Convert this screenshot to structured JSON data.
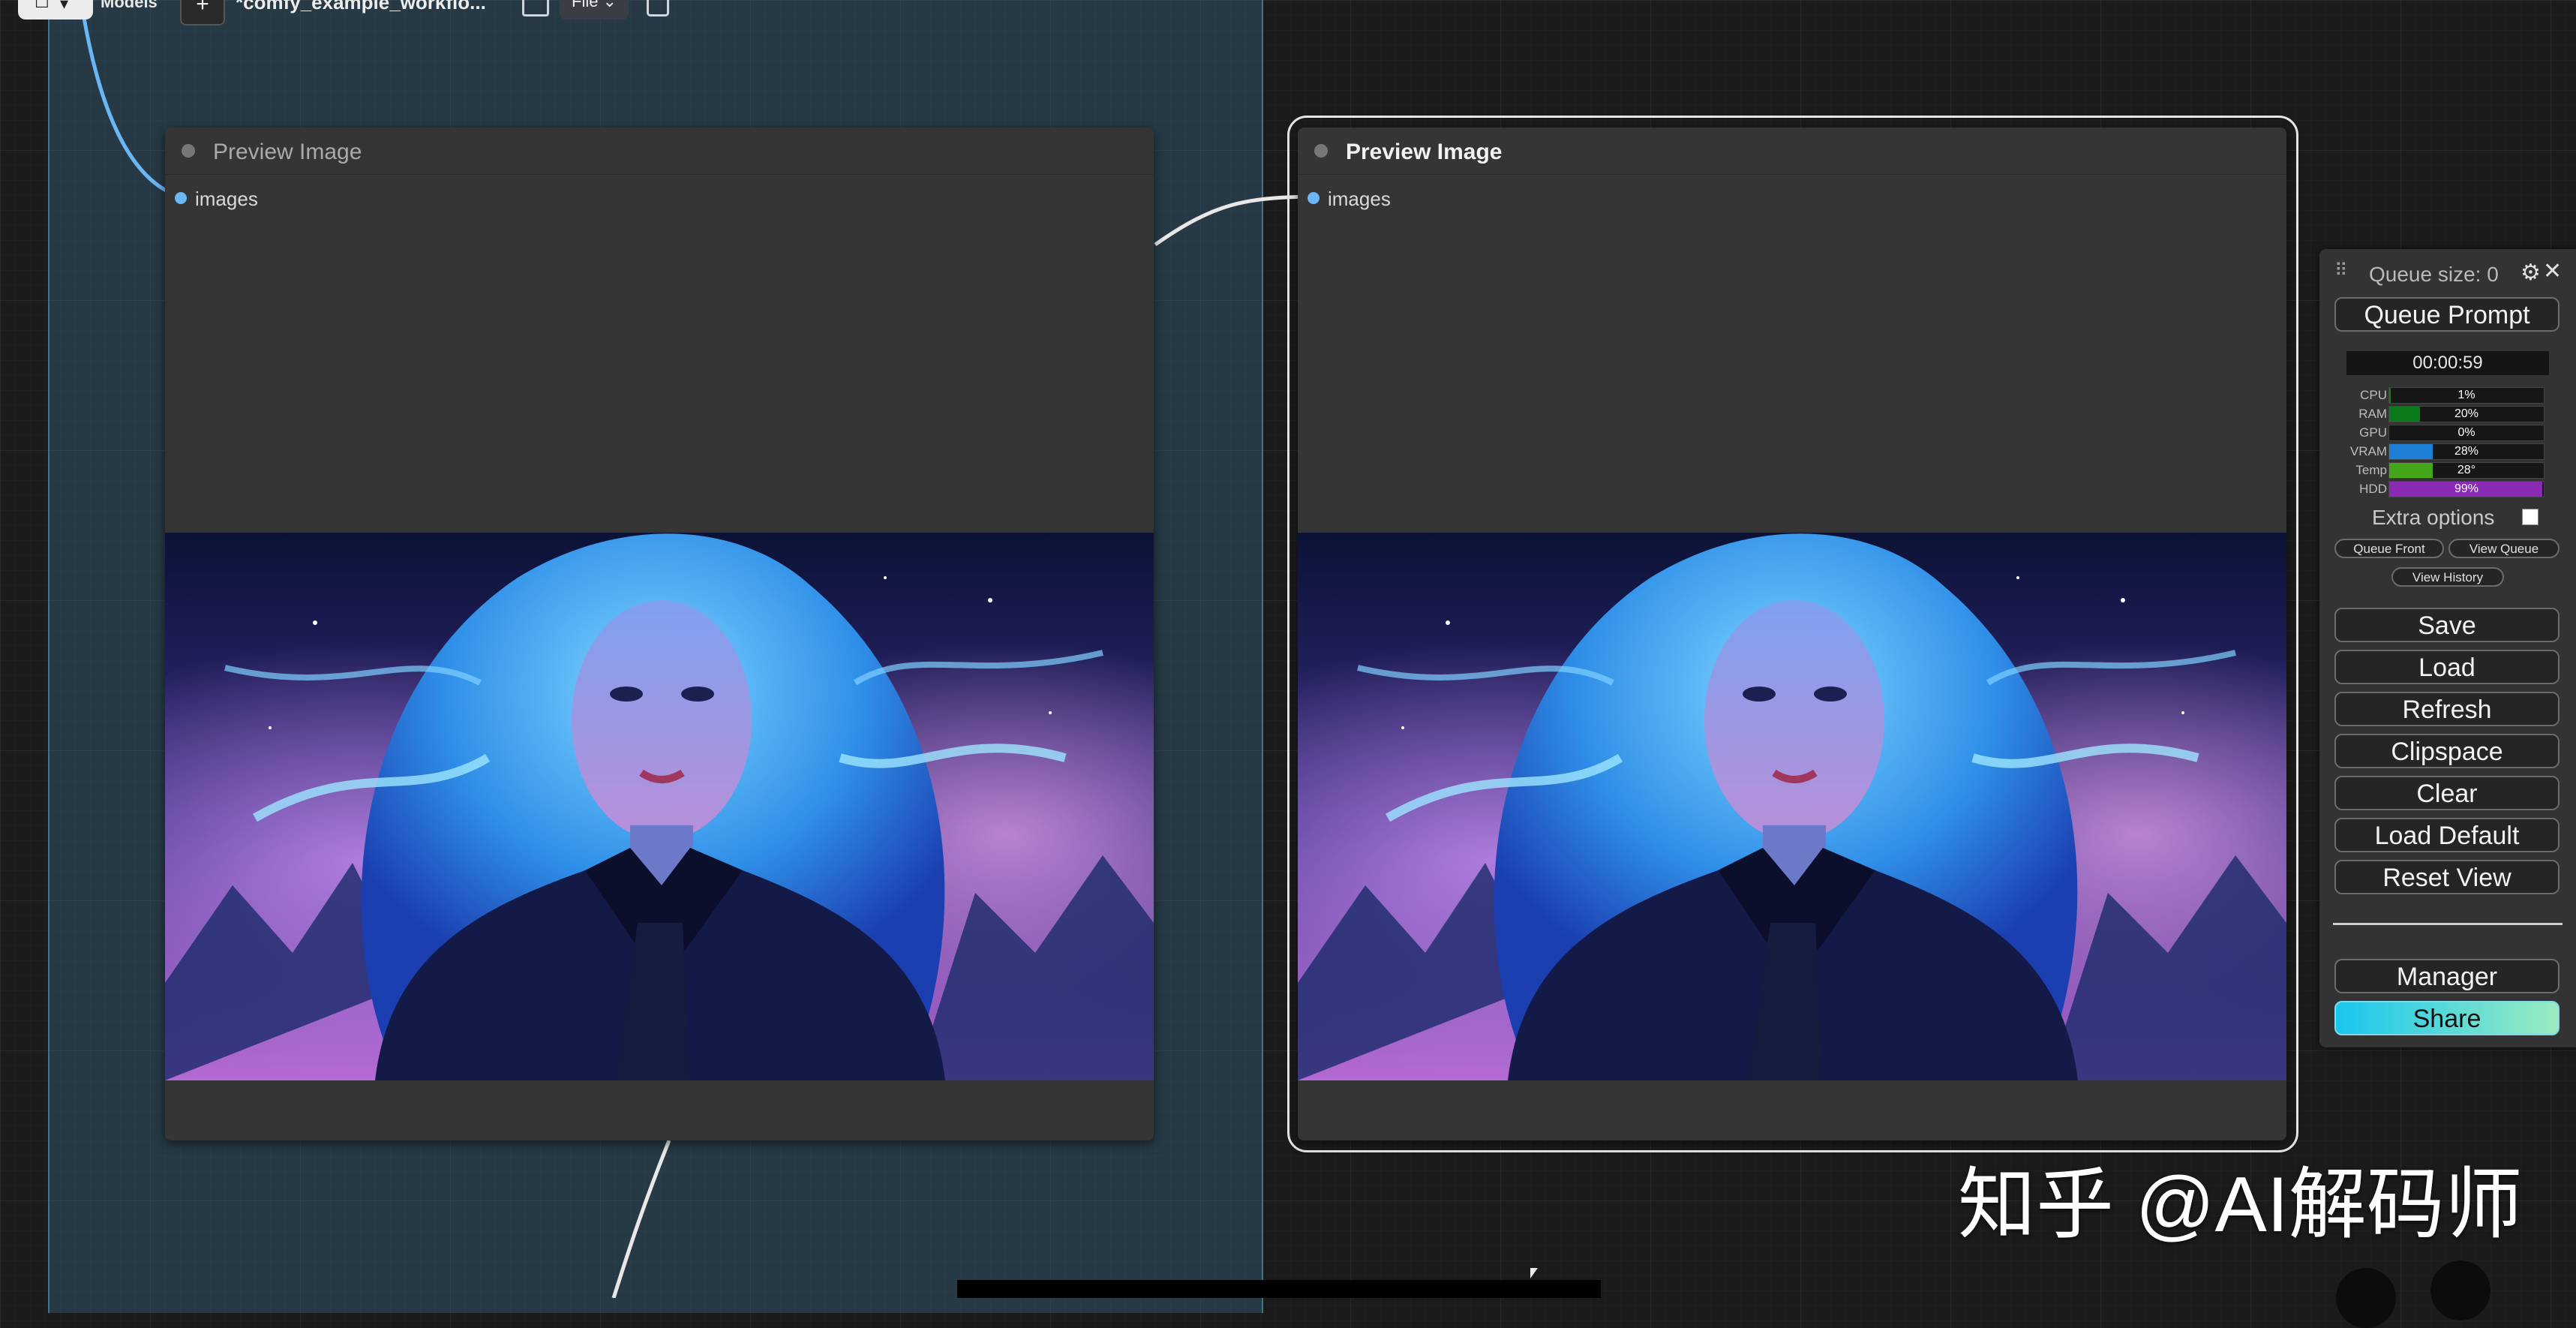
{
  "topbar": {
    "menu_glyph": "☐",
    "menu_chevron": "▾",
    "models_label": "Models",
    "new_tab_label": "+",
    "workflow_name": "*comfy_example_workflo...",
    "file_menu_label": "File ⌄"
  },
  "nodes": [
    {
      "title": "Preview Image",
      "input_slot": "images",
      "selected": false
    },
    {
      "title": "Preview Image",
      "input_slot": "images",
      "selected": true
    }
  ],
  "queue_panel": {
    "drag_handle": "⠿",
    "queue_size": "Queue size: 0",
    "settings_glyph": "⚙",
    "close_glyph": "✕",
    "queue_prompt": "Queue Prompt",
    "timer": "00:00:59",
    "stats": [
      {
        "label": "CPU",
        "value": "1%",
        "fraction": 0.01,
        "color": "#1e7a1e"
      },
      {
        "label": "RAM",
        "value": "20%",
        "fraction": 0.2,
        "color": "#0a7a1a"
      },
      {
        "label": "GPU",
        "value": "0%",
        "fraction": 0.0,
        "color": "#1e7a1e"
      },
      {
        "label": "VRAM",
        "value": "28%",
        "fraction": 0.28,
        "color": "#1d7fd6"
      },
      {
        "label": "Temp",
        "value": "28°",
        "fraction": 0.28,
        "color": "#46a61a"
      },
      {
        "label": "HDD",
        "value": "99%",
        "fraction": 0.99,
        "color": "#8a2ab5"
      }
    ],
    "extra_options": "Extra options",
    "queue_front": "Queue Front",
    "view_queue": "View Queue",
    "view_history": "View History",
    "buttons": [
      "Save",
      "Load",
      "Refresh",
      "Clipspace",
      "Clear",
      "Load Default",
      "Reset View"
    ],
    "manager": "Manager",
    "share": "Share"
  },
  "watermark": "知乎 @AI解码师"
}
